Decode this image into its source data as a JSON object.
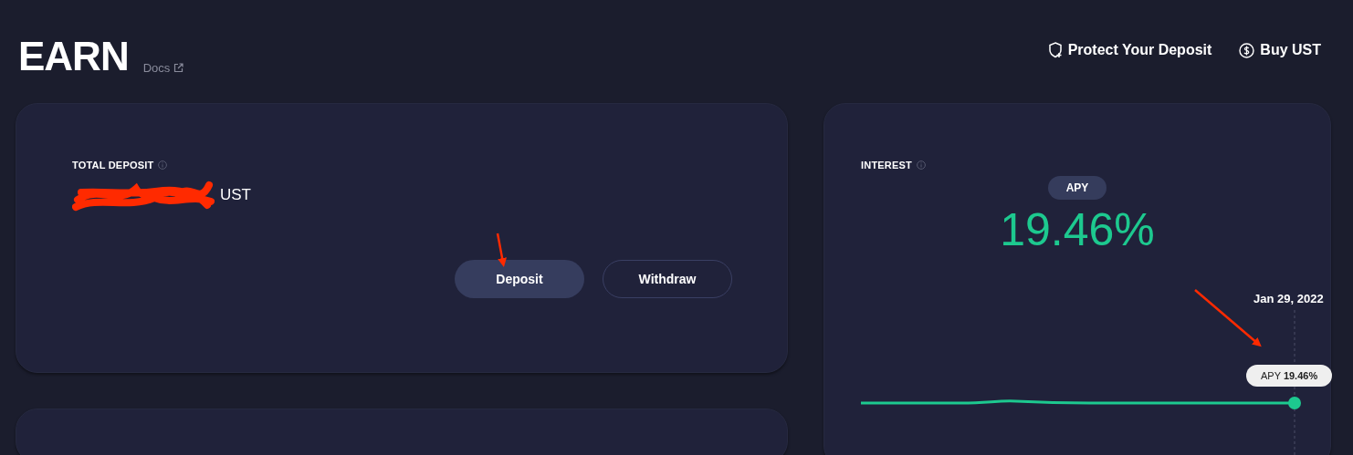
{
  "header": {
    "title": "EARN",
    "docs_link": "Docs",
    "actions": [
      {
        "label": "Protect Your Deposit",
        "kind": "shield"
      },
      {
        "label": "Buy UST",
        "kind": "dollar"
      }
    ]
  },
  "total_deposit": {
    "label": "TOTAL DEPOSIT",
    "amount_unit": "UST",
    "buttons": [
      {
        "label": "Deposit",
        "kind": "primary"
      },
      {
        "label": "Withdraw",
        "kind": "outline"
      }
    ]
  },
  "interest": {
    "label": "INTEREST",
    "badge": "APY",
    "rate": "19.46%",
    "chart": {
      "date": "Jan 29, 2022",
      "tooltip_label": "APY",
      "tooltip_value": "19.46%"
    }
  }
}
